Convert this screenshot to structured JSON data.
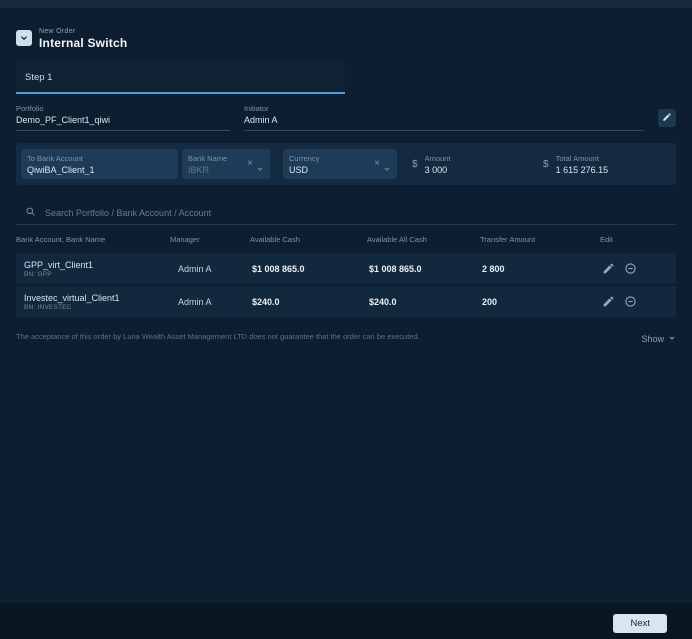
{
  "colors": {
    "accent": "#4aa3da",
    "page-bg": "#0a1622",
    "strip-bg": "#16293c",
    "card-bg": "#0d1e30",
    "panel-bg": "#132a40",
    "field-bg": "#1e3c57",
    "row-bg": "#12283c",
    "next-bg": "#d9e6f2"
  },
  "icons": {
    "clear": "×"
  },
  "header": {
    "overline": "New Order",
    "title": "Internal Switch"
  },
  "step_tab": "Step 1",
  "portfolio": {
    "label": "Portfolio",
    "value": "Demo_PF_Client1_qiwi"
  },
  "initiator": {
    "label": "Initiator",
    "value": "Admin A"
  },
  "switch_form": {
    "to_bank_account": {
      "label": "To Bank Account",
      "value": "QiwiBA_Client_1"
    },
    "bank_name": {
      "label": "Bank Name",
      "value": "IBKR"
    },
    "currency": {
      "label": "Currency",
      "value": "USD"
    },
    "amount": {
      "symbol": "$",
      "label": "Amount",
      "value": "3 000"
    },
    "total_amount": {
      "symbol": "$",
      "label": "Total Amount",
      "value": "1 615 276.15"
    }
  },
  "search": {
    "placeholder": "Search Portfolio / Bank Account / Account"
  },
  "table": {
    "headers": {
      "account": "Bank Account, Bank Name",
      "manager": "Manager",
      "available_cash": "Available Cash",
      "available_all_cash": "Available All Cash",
      "transfer_amount": "Transfer Amount",
      "edit": "Edit"
    },
    "rows": [
      {
        "name": "GPP_virt_Client1",
        "bank_name": "BN: GPP",
        "manager": "Admin A",
        "available_cash": "$1 008 865.0",
        "available_all_cash": "$1 008 865.0",
        "transfer_amount": "2 800"
      },
      {
        "name": "Investec_virtual_Client1",
        "bank_name": "BN: INVESTEC",
        "manager": "Admin A",
        "available_cash": "$240.0",
        "available_all_cash": "$240.0",
        "transfer_amount": "200"
      }
    ]
  },
  "footer": {
    "disclaimer": "The acceptance of this order by Luna Wealth Asset Management LTD does not guarantee that the order can be executed.",
    "show_label": "Show"
  },
  "actions": {
    "next": "Next"
  }
}
